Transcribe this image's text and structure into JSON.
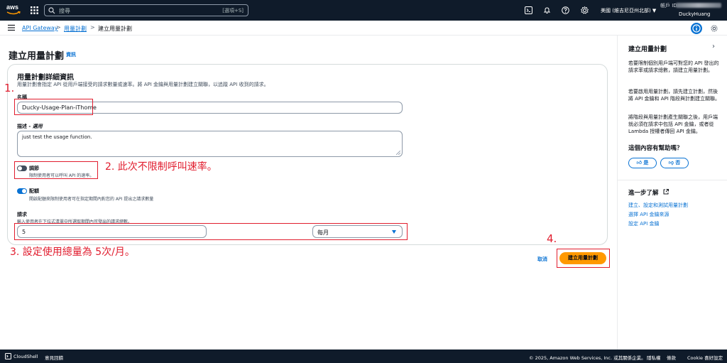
{
  "topnav": {
    "logo": "aws",
    "search_placeholder": "搜尋",
    "search_shortcut": "[選項+S]",
    "region": "美國 (維吉尼亞州北部)",
    "account_label": "帳戶 ID:",
    "account_name": "DuckyHuang"
  },
  "breadcrumb": {
    "items": [
      "API Gateway",
      "用量計劃",
      "建立用量計劃"
    ]
  },
  "main": {
    "title": "建立用量計劃",
    "title_info": "資訊",
    "section_title": "用量計劃詳細資訊",
    "section_desc": "用量計劃會指定 API 從用戶端接受的請求數量或速率。將 API 金鑰與用量計劃建立關聯，以追蹤 API 收到的請求。",
    "name_label": "名稱",
    "name_value": "Ducky-Usage-Plan-iThome",
    "desc_label": "描述 - ",
    "desc_optional": "選用",
    "desc_value": "just test the usage function.",
    "throttle_label": "調節",
    "throttle_desc": "限制使用者可以呼叫 API 的速率。",
    "throttle_on": false,
    "quota_label": "配額",
    "quota_desc": "開啟配額來限制使用者可在指定期間內對您的 API 提出之請求數量",
    "quota_on": true,
    "requests_label": "請求",
    "requests_desc": "輸入使用者在下拉式清單中所選取期間內可發出的請求總數。",
    "requests_value": "5",
    "period_value": "每月",
    "cancel_label": "取消",
    "create_label": "建立用量計劃"
  },
  "annotations": {
    "a1": "1.",
    "a2": "2. 此次不限制呼叫速率。",
    "a3": "3. 設定使用總量為 5次/月。",
    "a4": "4."
  },
  "side_panel": {
    "title": "建立用量計劃",
    "p1": "若要限制個別用戶端可對您的 API 發出的請求率或請求總數，請建立用量計劃。",
    "p2": "若要啟用用量計劃，請先建立計劃，然後將 API 金鑰和 API 階段與計劃建立關聯。",
    "p3": "將階段與用量計劃產生關聯之後，用戶端就必須在請求中包括 API 金鑰，或者從 Lambda 授權者傳回 API 金鑰。",
    "feedback_q": "這個內容有幫助嗎？",
    "yes": "是",
    "no": "否",
    "learn_more": "進一步了解",
    "links": [
      "建立、設定和測試用量計劃",
      "選擇 API 金鑰來源",
      "設定 API 金鑰"
    ]
  },
  "footer": {
    "cloudshell": "CloudShell",
    "feedback": "意見回饋",
    "copyright": "© 2025, Amazon Web Services, Inc. 或其關係企業。",
    "privacy": "隱私權",
    "terms": "條款",
    "cookie": "Cookie 喜好設定"
  },
  "colors": {
    "nav_bg": "#0f1b2a",
    "link": "#0972d3",
    "primary": "#ff9900",
    "annotation": "#e11d2e"
  }
}
